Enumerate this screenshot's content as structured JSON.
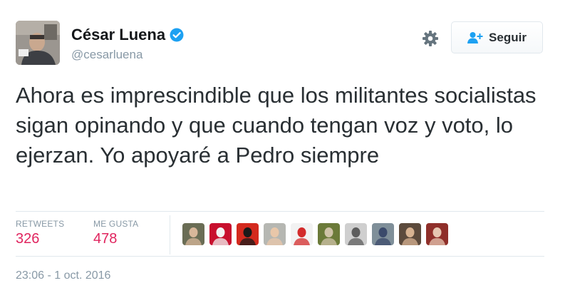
{
  "author": {
    "name": "César Luena",
    "handle": "@cesarluena",
    "verified": true
  },
  "actions": {
    "follow_label": "Seguir",
    "settings_icon": "gear-icon",
    "follow_icon": "user-plus-icon"
  },
  "tweet": {
    "text": "Ahora es imprescindible que los militantes socialistas sigan opinando y que cuando tengan voz y voto, lo ejerzan. Yo apoyaré a Pedro siempre"
  },
  "stats": {
    "retweets_label": "RETWEETS",
    "retweets_value": "326",
    "likes_label": "ME GUSTA",
    "likes_value": "478"
  },
  "likers": [
    {
      "bg": "#6a6d55",
      "fg": "#d8b79a"
    },
    {
      "bg": "#c8102e",
      "fg": "#f3f3f3"
    },
    {
      "bg": "#d42a1e",
      "fg": "#1a1a1a"
    },
    {
      "bg": "#b6b7b2",
      "fg": "#e9c7a9"
    },
    {
      "bg": "#f2f2f2",
      "fg": "#d32b2b"
    },
    {
      "bg": "#6b7a39",
      "fg": "#cfc3a8"
    },
    {
      "bg": "#cfcfcf",
      "fg": "#5d5d5d"
    },
    {
      "bg": "#7f8f99",
      "fg": "#3b4a6b"
    },
    {
      "bg": "#5c4a3c",
      "fg": "#d7b291"
    },
    {
      "bg": "#8f2f2a",
      "fg": "#e6c7b2"
    }
  ],
  "timestamp": "23:06 - 1 oct. 2016",
  "colors": {
    "accent_like": "#e0245e",
    "verified_blue": "#1da1f2",
    "muted": "#8899a6"
  }
}
